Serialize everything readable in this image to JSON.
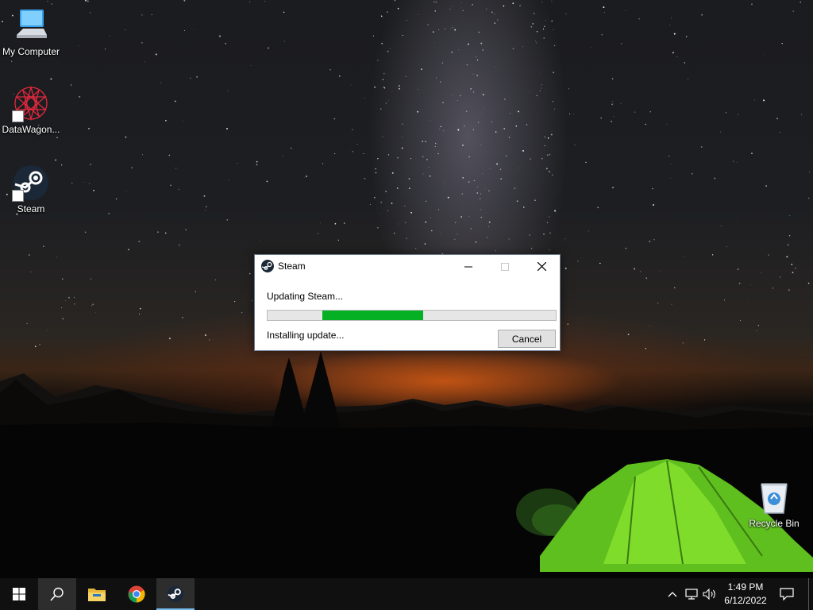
{
  "desktop": {
    "icons": [
      {
        "label": "My Computer",
        "icon": "my-computer-icon"
      },
      {
        "label": "DataWagon...",
        "icon": "datawagon-icon"
      },
      {
        "label": "Steam",
        "icon": "steam-icon"
      },
      {
        "label": "Recycle Bin",
        "icon": "recycle-bin-icon"
      }
    ]
  },
  "dialog": {
    "title": "Steam",
    "status_main": "Updating Steam...",
    "status_sub": "Installing update...",
    "progress": {
      "start_fraction": 0.19,
      "end_fraction": 0.54
    },
    "cancel_label": "Cancel",
    "colors": {
      "progress_fill": "#06b025"
    }
  },
  "taskbar": {
    "apps": [
      {
        "name": "start",
        "icon": "windows-logo-icon"
      },
      {
        "name": "search",
        "icon": "search-icon"
      },
      {
        "name": "file-explorer",
        "icon": "folder-icon"
      },
      {
        "name": "chrome",
        "icon": "chrome-icon"
      },
      {
        "name": "steam",
        "icon": "steam-icon"
      }
    ],
    "clock": {
      "time": "1:49 PM",
      "date": "6/12/2022"
    }
  }
}
